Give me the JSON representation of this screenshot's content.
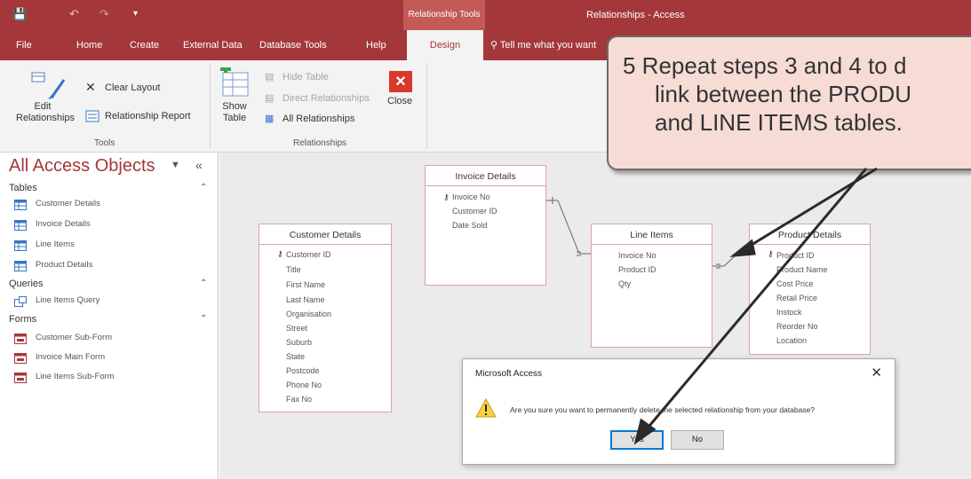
{
  "colors": {
    "accent": "#a4373a",
    "callout_bg": "#f6dcd5",
    "arrow": "#2b2b2b"
  },
  "titlebar": {
    "save_icon": "save-icon",
    "context_tab": "Relationship Tools",
    "window_title": "Relationships  -  Access"
  },
  "tabs": [
    "File",
    "Home",
    "Create",
    "External Data",
    "Database Tools",
    "Help",
    "Design"
  ],
  "tell_me": "Tell me what you want",
  "ribbon": {
    "edit_relationships": "Edit Relationships",
    "clear_layout": "Clear Layout",
    "relationship_report": "Relationship Report",
    "tools_label": "Tools",
    "show_table": "Show Table",
    "hide_table": "Hide Table",
    "direct_relationships": "Direct Relationships",
    "all_relationships": "All Relationships",
    "close": "Close",
    "relationships_label": "Relationships"
  },
  "nav": {
    "title": "All Access Objects",
    "sections": [
      {
        "label": "Tables",
        "items": [
          "Customer Details",
          "Invoice Details",
          "Line Items",
          "Product Details"
        ]
      },
      {
        "label": "Queries",
        "items": [
          "Line Items Query"
        ]
      },
      {
        "label": "Forms",
        "items": [
          "Customer Sub-Form",
          "Invoice Main Form",
          "Line Items Sub-Form"
        ]
      }
    ]
  },
  "tables": {
    "invoice": {
      "name": "Invoice Details",
      "fields": [
        "Invoice No",
        "Customer ID",
        "Date Sold"
      ]
    },
    "customer": {
      "name": "Customer Details",
      "fields": [
        "Customer ID",
        "Title",
        "First Name",
        "Last Name",
        "Organisation",
        "Street",
        "Suburb",
        "State",
        "Postcode",
        "Phone No",
        "Fax No"
      ]
    },
    "lineitems": {
      "name": "Line Items",
      "fields": [
        "Invoice No",
        "Product ID",
        "Qty"
      ]
    },
    "product": {
      "name": "Product Details",
      "fields": [
        "Product ID",
        "Product Name",
        "Cost Price",
        "Retail Price",
        "Instock",
        "Reorder No",
        "Location"
      ]
    }
  },
  "callout": {
    "line1": "5  Repeat steps 3 and 4 to d",
    "line2": "link between the PRODU",
    "line3": "and LINE ITEMS tables."
  },
  "dialog": {
    "title": "Microsoft Access",
    "message": "Are you sure you want to permanently delete the selected relationship from your database?",
    "yes": "Yes",
    "no": "No"
  }
}
